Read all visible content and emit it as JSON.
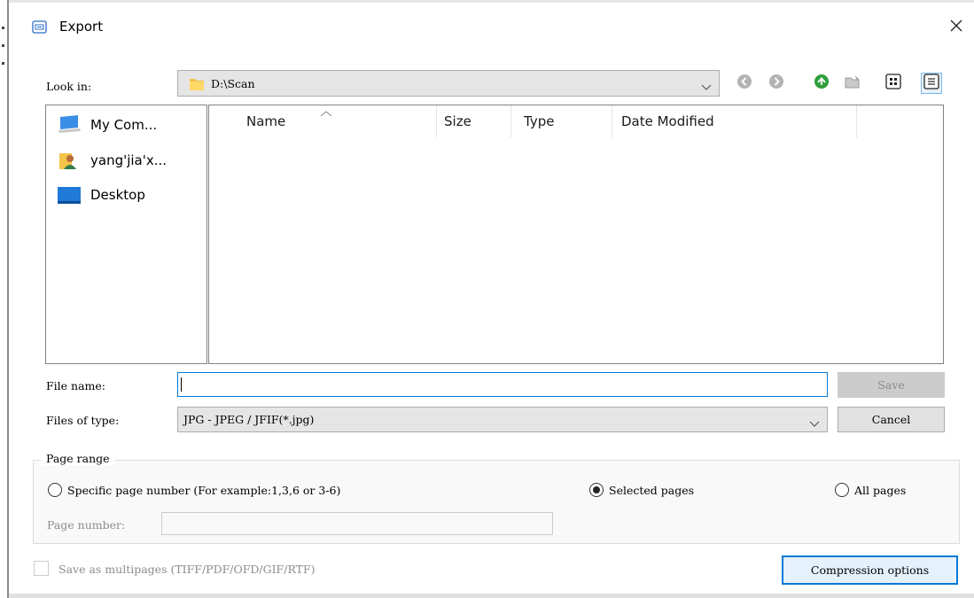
{
  "dialog": {
    "title": "Export",
    "close_glyph": "✕"
  },
  "look_in": {
    "label": "Look in:",
    "value": "D:\\Scan"
  },
  "toolbar": {
    "icons": [
      "back-icon",
      "forward-icon",
      "up-folder-icon",
      "new-folder-icon",
      "list-view-icon",
      "detail-view-icon"
    ]
  },
  "sidebar": {
    "items": [
      {
        "label": "My Com...",
        "icon": "computer-icon"
      },
      {
        "label": "yang'jia'x...",
        "icon": "user-folder-icon"
      },
      {
        "label": "Desktop",
        "icon": "desktop-icon"
      }
    ]
  },
  "file_list": {
    "columns": [
      "Name",
      "Size",
      "Type",
      "Date Modified"
    ],
    "sorted_by": "Name",
    "rows": []
  },
  "file_name": {
    "label": "File name:",
    "value": ""
  },
  "file_type": {
    "label": "Files of type:",
    "value": "JPG - JPEG / JFIF(*.jpg)"
  },
  "buttons": {
    "save": "Save",
    "cancel": "Cancel",
    "compression": "Compression options"
  },
  "page_range": {
    "title": "Page range",
    "specific_label": "Specific page number (For example:1,3,6 or 3-6)",
    "selected_label": "Selected pages",
    "all_label": "All pages",
    "selected_option": "Selected pages",
    "page_number_label": "Page number:",
    "page_number_value": ""
  },
  "multipage": {
    "label": "Save as multipages (TIFF/PDF/OFD/GIF/RTF)",
    "checked": false
  },
  "colors": {
    "accent": "#0078d7",
    "disabled_text": "#8c8c8c",
    "nav_green": "#2e9e3a"
  }
}
